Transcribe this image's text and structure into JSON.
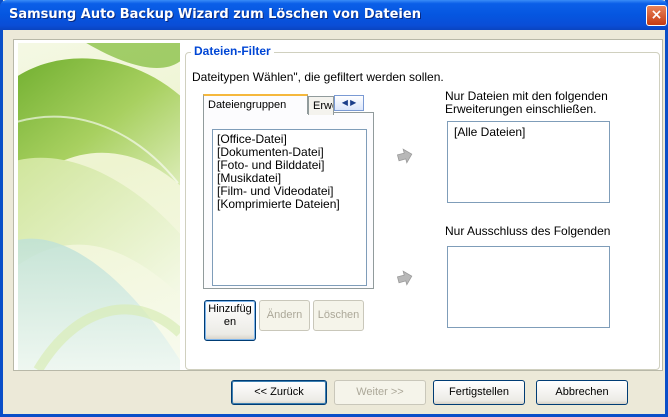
{
  "window": {
    "title": "Samsung Auto Backup Wizard zum Löschen von Dateien",
    "close_label": "×"
  },
  "filter": {
    "group_title": "Dateien-Filter",
    "instruction": "Dateitypen Wählen\", die gefiltert werden sollen.",
    "tabs": [
      {
        "label": "Dateiengruppen",
        "active": true
      },
      {
        "label": "Erweiterungen",
        "active": false
      }
    ],
    "tab_scroll": "◀ ▶",
    "groups": [
      "[Office-Datei]",
      "[Dokumenten-Datei]",
      "[Foto- und Bilddatei]",
      "[Musikdatei]",
      "[Film- und Videodatei]",
      "[Komprimierte Dateien]"
    ],
    "buttons": {
      "add": "Hinzufüg en",
      "change": "Ändern",
      "delete": "Löschen"
    },
    "include_label": "Nur Dateien mit den folgenden Erweiterungen einschließen.",
    "include_items": [
      "[Alle Dateien]"
    ],
    "exclude_label": "Nur Ausschluss des Folgenden",
    "exclude_items": []
  },
  "footer": {
    "back": "<< Zurück",
    "next": "Weiter >>",
    "finish": "Fertigstellen",
    "cancel": "Abbrechen"
  },
  "colors": {
    "title_bar": "#0556e0",
    "group_title": "#0046d5",
    "close_button": "#c63a12"
  },
  "icons": {
    "arrow_include": "arrow-right-icon",
    "arrow_exclude": "arrow-right-icon"
  }
}
